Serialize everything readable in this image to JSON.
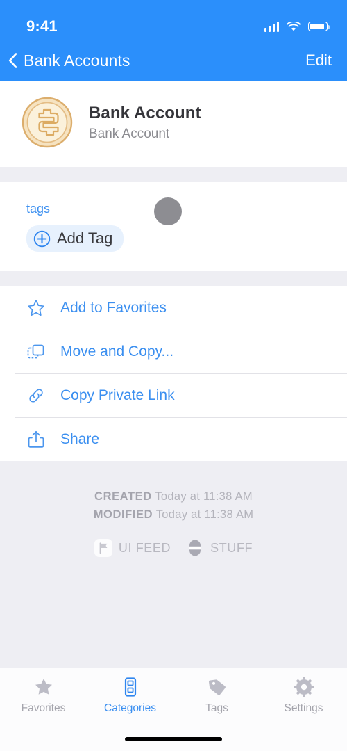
{
  "statusbar": {
    "time": "9:41",
    "signal_icon": "cellular-signal-icon",
    "wifi_icon": "wifi-icon",
    "battery_icon": "battery-icon"
  },
  "navbar": {
    "back_icon": "chevron-left-icon",
    "back_label": "Bank Accounts",
    "edit_label": "Edit"
  },
  "detail": {
    "icon": "gold-coin-dollar-icon",
    "title": "Bank Account",
    "subtitle": "Bank Account"
  },
  "tags": {
    "label": "tags",
    "swatch_color": "#8d8d92",
    "add_tag_label": "Add Tag",
    "add_tag_icon": "plus-circle-icon"
  },
  "actions": [
    {
      "icon": "star-outline-icon",
      "label": "Add to Favorites"
    },
    {
      "icon": "move-copy-icon",
      "label": "Move and Copy..."
    },
    {
      "icon": "link-icon",
      "label": "Copy Private Link"
    },
    {
      "icon": "share-icon",
      "label": "Share"
    }
  ],
  "meta": {
    "created_label": "CREATED",
    "created_value": "Today at 11:38 AM",
    "modified_label": "MODIFIED",
    "modified_value": "Today at 11:38 AM",
    "badges": [
      {
        "icon": "flag-icon",
        "label": "UI FEED"
      },
      {
        "icon": "stuff-icon",
        "label": "STUFF"
      }
    ]
  },
  "tabbar": {
    "items": [
      {
        "icon": "star-filled-icon",
        "label": "Favorites",
        "active": false
      },
      {
        "icon": "file-cabinet-icon",
        "label": "Categories",
        "active": true
      },
      {
        "icon": "tag-icon",
        "label": "Tags",
        "active": false
      },
      {
        "icon": "gear-icon",
        "label": "Settings",
        "active": false
      }
    ]
  },
  "colors": {
    "header_blue": "#2b8ffb",
    "accent_blue": "#3b8ff0",
    "section_bg": "#eeeef3",
    "coin_gold": "#e0b375"
  }
}
